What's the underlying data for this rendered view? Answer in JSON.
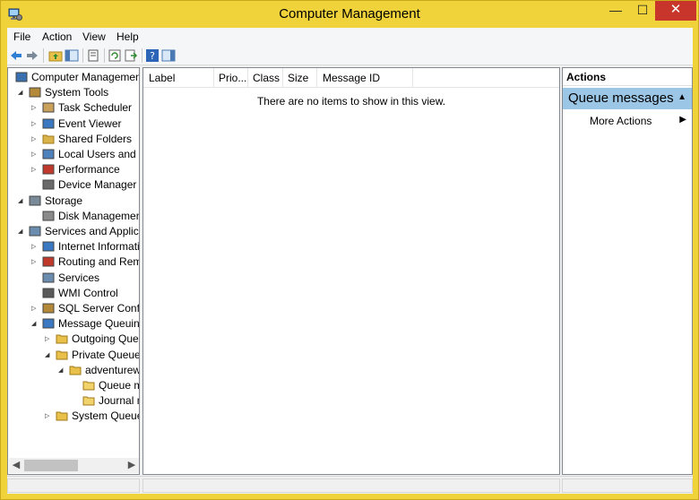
{
  "window": {
    "title": "Computer Management",
    "minimize_glyph": "—",
    "maximize_glyph": "☐",
    "close_glyph": "✕"
  },
  "menu": [
    "File",
    "Action",
    "View",
    "Help"
  ],
  "tree": {
    "items": [
      {
        "label": "Computer Management",
        "icon": "computer-management-icon",
        "level": 0,
        "expand": ""
      },
      {
        "label": "System Tools",
        "icon": "tools-icon",
        "level": 1,
        "expand": "expanded"
      },
      {
        "label": "Task Scheduler",
        "icon": "clock-icon",
        "level": 2,
        "expand": "collapsed"
      },
      {
        "label": "Event Viewer",
        "icon": "event-viewer-icon",
        "level": 2,
        "expand": "collapsed"
      },
      {
        "label": "Shared Folders",
        "icon": "shared-folder-icon",
        "level": 2,
        "expand": "collapsed"
      },
      {
        "label": "Local Users and Gro",
        "icon": "users-icon",
        "level": 2,
        "expand": "collapsed"
      },
      {
        "label": "Performance",
        "icon": "performance-icon",
        "level": 2,
        "expand": "collapsed"
      },
      {
        "label": "Device Manager",
        "icon": "device-manager-icon",
        "level": 2,
        "expand": ""
      },
      {
        "label": "Storage",
        "icon": "storage-icon",
        "level": 1,
        "expand": "expanded"
      },
      {
        "label": "Disk Management",
        "icon": "disk-icon",
        "level": 2,
        "expand": ""
      },
      {
        "label": "Services and Applicat",
        "icon": "services-apps-icon",
        "level": 1,
        "expand": "expanded"
      },
      {
        "label": "Internet Informatio",
        "icon": "iis-icon",
        "level": 2,
        "expand": "collapsed"
      },
      {
        "label": "Routing and Remo",
        "icon": "routing-icon",
        "level": 2,
        "expand": "collapsed"
      },
      {
        "label": "Services",
        "icon": "services-icon",
        "level": 2,
        "expand": ""
      },
      {
        "label": "WMI Control",
        "icon": "wmi-icon",
        "level": 2,
        "expand": ""
      },
      {
        "label": "SQL Server Configu",
        "icon": "sql-server-icon",
        "level": 2,
        "expand": "collapsed"
      },
      {
        "label": "Message Queuing",
        "icon": "message-queuing-icon",
        "level": 2,
        "expand": "expanded"
      },
      {
        "label": "Outgoing Queue",
        "icon": "folder-icon",
        "level": 3,
        "expand": "collapsed"
      },
      {
        "label": "Private Queues",
        "icon": "folder-icon",
        "level": 3,
        "expand": "expanded"
      },
      {
        "label": "adventurewo",
        "icon": "queue-folder-icon",
        "level": 4,
        "expand": "expanded"
      },
      {
        "label": "Queue me",
        "icon": "queue-messages-icon",
        "level": 5,
        "expand": ""
      },
      {
        "label": "Journal me",
        "icon": "journal-messages-icon",
        "level": 5,
        "expand": ""
      },
      {
        "label": "System Queues",
        "icon": "folder-icon",
        "level": 3,
        "expand": "collapsed"
      }
    ]
  },
  "list": {
    "columns": [
      "Label",
      "Prio...",
      "Class",
      "Size",
      "Message ID"
    ],
    "empty_text": "There are no items to show in this view."
  },
  "actions": {
    "header": "Actions",
    "group": "Queue messages",
    "items": [
      "More Actions"
    ]
  },
  "colors": {
    "title_bar": "#f0d23a",
    "close_button": "#c7352b",
    "selected_group": "#9cc6e6"
  }
}
